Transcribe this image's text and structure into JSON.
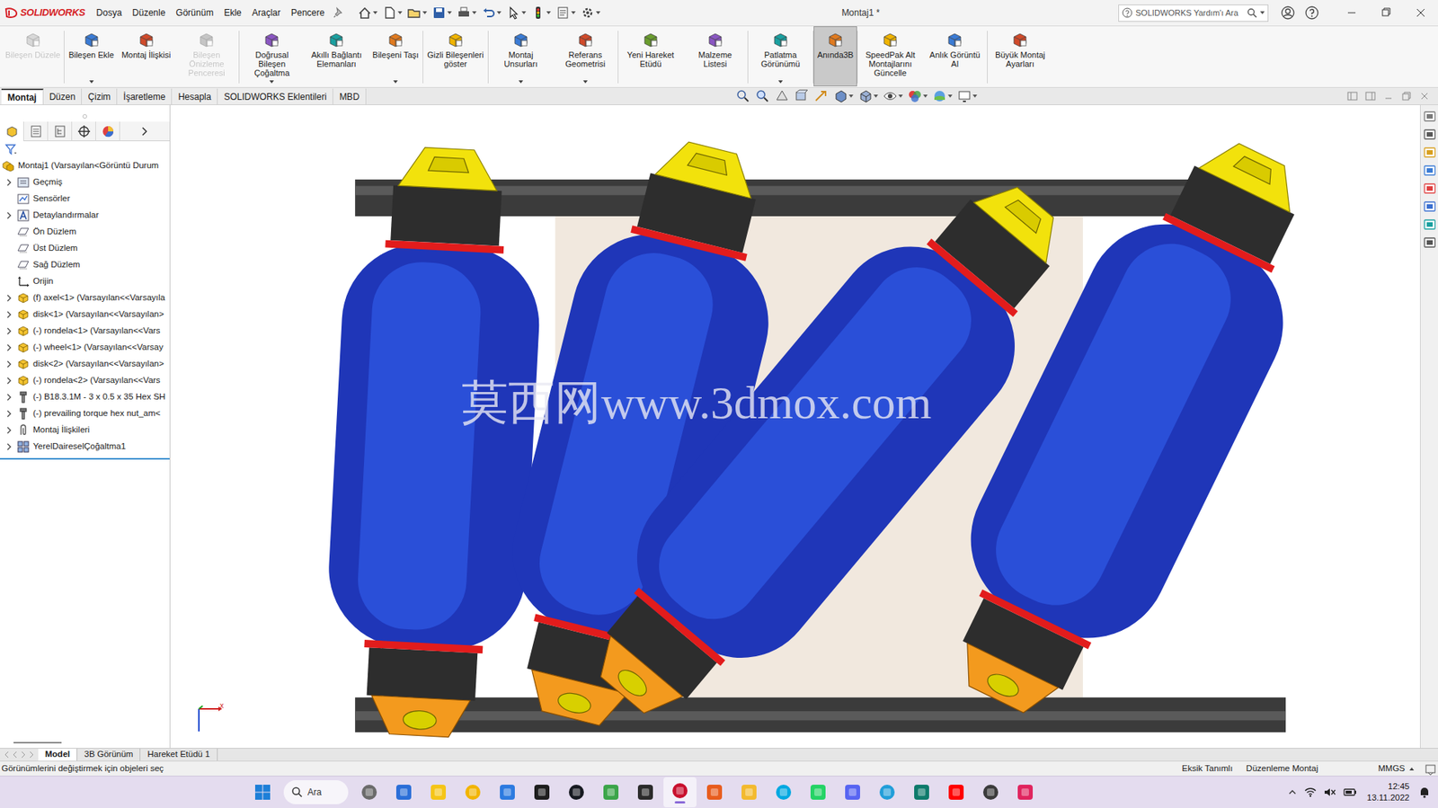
{
  "app": {
    "logo": "SOLIDWORKS"
  },
  "menu": [
    "Dosya",
    "Düzenle",
    "Görünüm",
    "Ekle",
    "Araçlar",
    "Pencere"
  ],
  "window": {
    "title": "Montaj1 *"
  },
  "search": {
    "placeholder": "SOLIDWORKS Yardım'ı Ara"
  },
  "ribbon": [
    {
      "label": "Bileşen Düzele",
      "disabled": true,
      "dropdown": false,
      "selected": false
    },
    {
      "label": "Bileşen Ekle",
      "disabled": false,
      "dropdown": true,
      "selected": false
    },
    {
      "label": "Montaj İlişkisi",
      "disabled": false,
      "dropdown": false,
      "selected": false
    },
    {
      "label": "Bileşen Önizleme Penceresi",
      "disabled": true,
      "dropdown": false,
      "selected": false
    },
    {
      "label": "Doğrusal Bileşen Çoğaltma",
      "disabled": false,
      "dropdown": true,
      "selected": false
    },
    {
      "label": "Akıllı Bağlantı Elemanları",
      "disabled": false,
      "dropdown": false,
      "selected": false
    },
    {
      "label": "Bileşeni Taşı",
      "disabled": false,
      "dropdown": true,
      "selected": false
    },
    {
      "label": "Gizli Bileşenleri göster",
      "disabled": false,
      "dropdown": false,
      "selected": false
    },
    {
      "label": "Montaj Unsurları",
      "disabled": false,
      "dropdown": true,
      "selected": false
    },
    {
      "label": "Referans Geometrisi",
      "disabled": false,
      "dropdown": true,
      "selected": false
    },
    {
      "label": "Yeni Hareket Etüdü",
      "disabled": false,
      "dropdown": false,
      "selected": false
    },
    {
      "label": "Malzeme Listesi",
      "disabled": false,
      "dropdown": false,
      "selected": false
    },
    {
      "label": "Patlatma Görünümü",
      "disabled": false,
      "dropdown": true,
      "selected": false
    },
    {
      "label": "Anında3B",
      "disabled": false,
      "dropdown": false,
      "selected": true
    },
    {
      "label": "SpeedPak Alt Montajlarını Güncelle",
      "disabled": false,
      "dropdown": false,
      "selected": false
    },
    {
      "label": "Anlık Görüntü Al",
      "disabled": false,
      "dropdown": false,
      "selected": false
    },
    {
      "label": "Büyük Montaj Ayarları",
      "disabled": false,
      "dropdown": false,
      "selected": false
    }
  ],
  "tabs": [
    {
      "label": "Montaj",
      "selected": true
    },
    {
      "label": "Düzen",
      "selected": false
    },
    {
      "label": "Çizim",
      "selected": false
    },
    {
      "label": "İşaretleme",
      "selected": false
    },
    {
      "label": "Hesapla",
      "selected": false
    },
    {
      "label": "SOLIDWORKS Eklentileri",
      "selected": false
    },
    {
      "label": "MBD",
      "selected": false
    }
  ],
  "tree": {
    "items": [
      {
        "label": "Montaj1  (Varsayılan<Görüntü Durum",
        "kind": "assembly",
        "expandable": false,
        "expanded": true
      },
      {
        "label": "Geçmiş",
        "kind": "history",
        "expandable": true,
        "expanded": false
      },
      {
        "label": "Sensörler",
        "kind": "sensor",
        "expandable": false,
        "expanded": false
      },
      {
        "label": "Detaylandırmalar",
        "kind": "annotation",
        "expandable": true,
        "expanded": false
      },
      {
        "label": "Ön Düzlem",
        "kind": "plane",
        "expandable": false,
        "expanded": false
      },
      {
        "label": "Üst Düzlem",
        "kind": "plane",
        "expandable": false,
        "expanded": false
      },
      {
        "label": "Sağ Düzlem",
        "kind": "plane",
        "expandable": false,
        "expanded": false
      },
      {
        "label": "Orijin",
        "kind": "origin",
        "expandable": false,
        "expanded": false
      },
      {
        "label": "(f) axel<1> (Varsayılan<<Varsayıla",
        "kind": "part",
        "expandable": true,
        "expanded": false
      },
      {
        "label": "disk<1> (Varsayılan<<Varsayılan>",
        "kind": "part",
        "expandable": true,
        "expanded": false
      },
      {
        "label": "(-) rondela<1> (Varsayılan<<Vars",
        "kind": "part",
        "expandable": true,
        "expanded": false
      },
      {
        "label": "(-) wheel<1> (Varsayılan<<Varsay",
        "kind": "part",
        "expandable": true,
        "expanded": false
      },
      {
        "label": "disk<2> (Varsayılan<<Varsayılan>",
        "kind": "part",
        "expandable": true,
        "expanded": false
      },
      {
        "label": "(-) rondela<2> (Varsayılan<<Vars",
        "kind": "part",
        "expandable": true,
        "expanded": false
      },
      {
        "label": "(-) B18.3.1M - 3 x 0.5 x 35 Hex SH",
        "kind": "fastener",
        "expandable": true,
        "expanded": false
      },
      {
        "label": "(-) prevailing torque hex nut_am<",
        "kind": "fastener",
        "expandable": true,
        "expanded": false
      },
      {
        "label": "Montaj İlişkileri",
        "kind": "mates",
        "expandable": true,
        "expanded": false
      },
      {
        "label": "YerelDaireselÇoğaltma1",
        "kind": "pattern",
        "expandable": true,
        "expanded": false
      }
    ]
  },
  "viewport": {
    "watermark": "莫西网www.3dmox.com",
    "axis_label": "x"
  },
  "bottom_tabs": [
    {
      "label": "Model",
      "selected": true
    },
    {
      "label": "3B Görünüm",
      "selected": false
    },
    {
      "label": "Hareket Etüdü 1",
      "selected": false
    }
  ],
  "status_bar": {
    "message": "Görünümlerini değiştirmek için objeleri seç",
    "definition": "Eksik Tanımlı",
    "mode": "Düzenleme Montaj",
    "units": "MMGS"
  },
  "taskbar": {
    "search": "Ara",
    "time": "12:45",
    "date": "13.11.2022"
  }
}
